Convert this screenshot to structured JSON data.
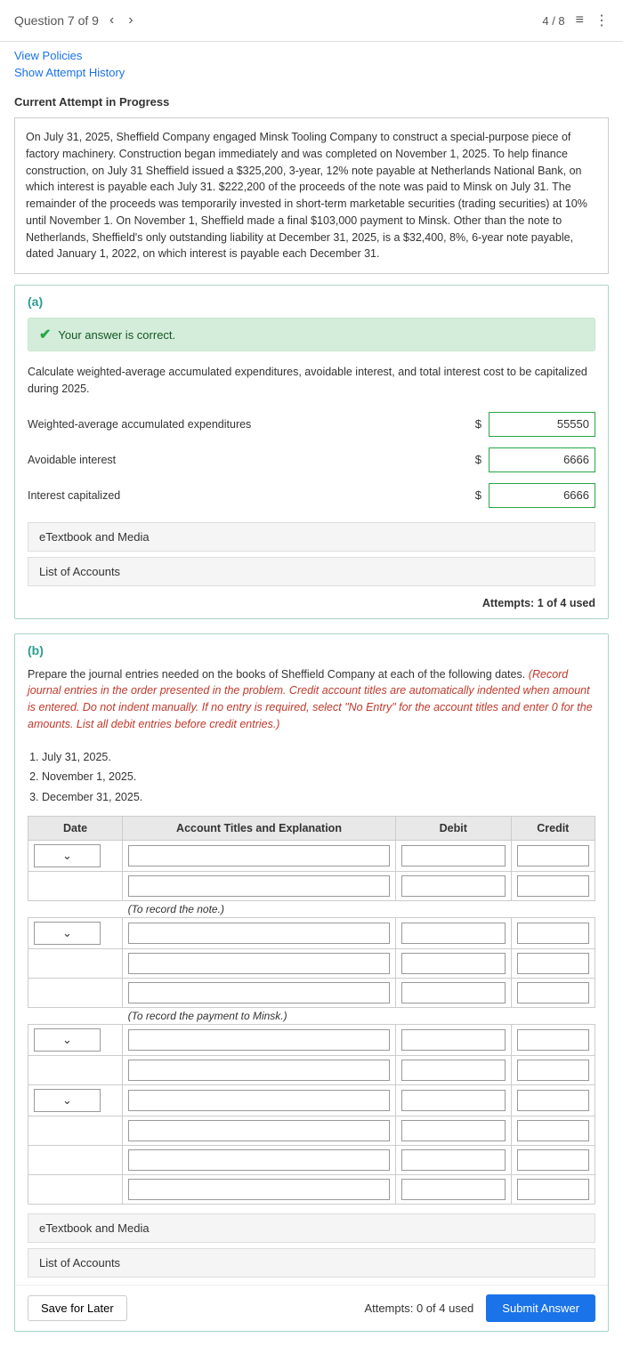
{
  "header": {
    "question_label": "Question 7 of 9",
    "pagination": "4 / 8",
    "prev_icon": "‹",
    "next_icon": "›",
    "list_icon": "≡",
    "more_icon": "⋮"
  },
  "top_links": {
    "view_policies": "View Policies",
    "show_attempt": "Show Attempt History"
  },
  "attempt_label": "Current Attempt in Progress",
  "problem_text": "On July 31, 2025, Sheffield Company engaged Minsk Tooling Company to construct a special-purpose piece of factory machinery. Construction began immediately and was completed on November 1, 2025. To help finance construction, on July 31 Sheffield issued a $325,200, 3-year, 12% note payable at Netherlands National Bank, on which interest is payable each July 31. $222,200 of the proceeds of the note was paid to Minsk on July 31. The remainder of the proceeds was temporarily invested in short-term marketable securities (trading securities) at 10% until November 1. On November 1, Sheffield made a final $103,000 payment to Minsk. Other than the note to Netherlands, Sheffield's only outstanding liability at December 31, 2025, is a $32,400, 8%, 6-year note payable, dated January 1, 2022, on which interest is payable each December 31.",
  "section_a": {
    "label": "(a)",
    "correct_banner": "Your answer is correct.",
    "instruction": "Calculate weighted-average accumulated expenditures, avoidable interest, and total interest cost to be capitalized during 2025.",
    "fields": [
      {
        "label": "Weighted-average accumulated expenditures",
        "value": "55550"
      },
      {
        "label": "Avoidable interest",
        "value": "6666"
      },
      {
        "label": "Interest capitalized",
        "value": "6666"
      }
    ],
    "etextbook_label": "eTextbook and Media",
    "list_accounts_label": "List of Accounts",
    "attempts_label": "Attempts: 1 of 4 used"
  },
  "section_b": {
    "label": "(b)",
    "instruction_normal": "Prepare the journal entries needed on the books of Sheffield Company at each of the following dates.",
    "instruction_red": "(Record journal entries in the order presented in the problem. Credit account titles are automatically indented when amount is entered. Do not indent manually. If no entry is required, select \"No Entry\" for the account titles and enter 0 for the amounts. List all debit entries before credit entries.)",
    "dates": [
      {
        "num": "1.",
        "date": "July 31, 2025."
      },
      {
        "num": "2.",
        "date": "November 1, 2025."
      },
      {
        "num": "3.",
        "date": "December 31, 2025."
      }
    ],
    "table_headers": {
      "date": "Date",
      "account": "Account Titles and Explanation",
      "debit": "Debit",
      "credit": "Credit"
    },
    "note_rows": [
      {
        "text": "(To record the note.)"
      },
      {
        "text": "(To record the payment to Minsk.)"
      }
    ],
    "etextbook_label": "eTextbook and Media",
    "list_accounts_label": "List of Accounts",
    "attempts_label": "Attempts: 0 of 4 used",
    "save_label": "Save for Later",
    "submit_label": "Submit Answer"
  }
}
